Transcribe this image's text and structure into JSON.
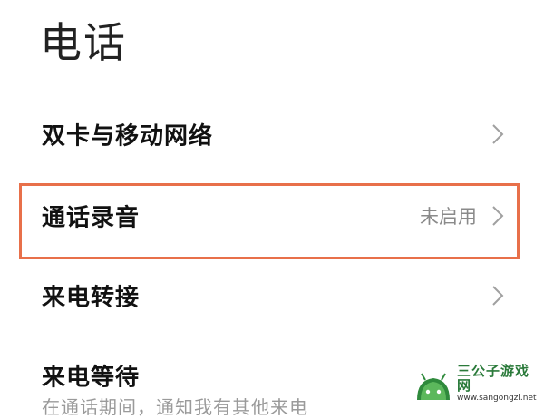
{
  "page": {
    "title": "电话"
  },
  "settings": [
    {
      "label": "双卡与移动网络",
      "value": ""
    },
    {
      "label": "通话录音",
      "value": "未启用"
    },
    {
      "label": "来电转接",
      "value": ""
    },
    {
      "label": "来电等待",
      "value": "",
      "subtitle": "在通话期间，通知我有其他来电"
    }
  ],
  "colors": {
    "highlight_border": "#e8704a",
    "chevron": "#a0a0a0"
  },
  "watermark": {
    "title": "三公子游戏网",
    "url": "www.sangongzi.net"
  }
}
